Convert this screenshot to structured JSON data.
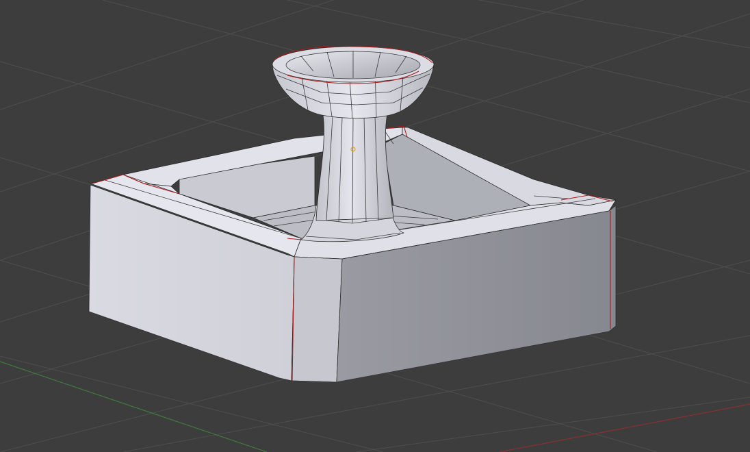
{
  "viewport": {
    "background": "#3d3d3d",
    "grid_color": "#4e4e4e",
    "x_axis_color": "#8a3030",
    "y_axis_color": "#3f7a3f"
  },
  "mesh": {
    "description_name": "fountain",
    "face_color": "#d5d6e0",
    "shadow_face_color": "#8a8c94",
    "seam_color": "#b01818",
    "origin_color": "#e0a020"
  }
}
